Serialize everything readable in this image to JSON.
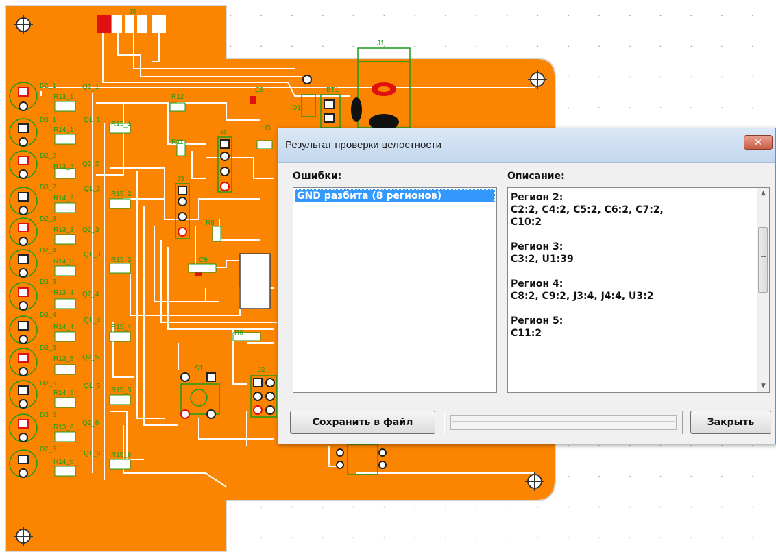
{
  "pcb": {
    "labels": {
      "j5": "J5",
      "j1": "J1",
      "bt1": "BT1",
      "c8": "C8",
      "r12": "R12",
      "j4": "J4",
      "u3": "U3",
      "r11": "R11",
      "j3": "J3",
      "r8": "R8",
      "c9": "C9",
      "r6": "R6",
      "s1": "S1",
      "j2": "J2",
      "d1": "D1",
      "d2_1": "D2_1",
      "r13_1": "R13_1",
      "q2_1": "Q2_1",
      "d3_1": "D3_1",
      "r14_1": "R14_1",
      "q1_1": "Q1_1",
      "r15_1": "R15_1",
      "d2_2": "D2_2",
      "r13_2": "R13_2",
      "q2_2": "Q2_2",
      "d3_2": "D3_2",
      "r14_2": "R14_2",
      "q1_2": "Q1_2",
      "r15_2": "R15_2",
      "d2_3": "D2_3",
      "r13_3": "R13_3",
      "q2_3": "Q2_3",
      "d2_4": "D2_4",
      "r14_3": "R14_3",
      "q1_3": "Q1_3",
      "r15_3": "R15_3",
      "d3_3": "D3_3",
      "r13_4": "R13_4",
      "q2_4": "Q2_4",
      "d3_4": "D3_4",
      "r14_4": "R14_4",
      "q1_4": "Q1_4",
      "r15_4": "R15_4",
      "d3_5": "D3_5",
      "r13_5": "R13_5",
      "q2_5": "Q2_5",
      "d2_5": "D2_5",
      "r14_5": "R14_5",
      "q1_5": "Q1_5",
      "r15_5": "R15_5",
      "d3_6": "D3_6",
      "r13_6": "R13_6",
      "q2_6": "Q2_6",
      "d2_6": "D2_6",
      "r14_6": "R14_6",
      "q1_6": "Q1_6",
      "r15_6": "R15_6"
    }
  },
  "dialog": {
    "title": "Результат проверки целостности",
    "close_glyph": "✕",
    "errors_label": "Ошибки:",
    "description_label": "Описание:",
    "errors": [
      "GND разбита (8 регионов)"
    ],
    "regions": [
      {
        "title": "Регион 2:",
        "line1": "C2:2, C4:2, C5:2, C6:2, C7:2,",
        "line2": "C10:2"
      },
      {
        "title": "Регион 3:",
        "line1": "C3:2, U1:39"
      },
      {
        "title": "Регион 4:",
        "line1": "C8:2, C9:2, J3:4, J4:4, U3:2"
      },
      {
        "title": "Регион 5:",
        "line1": "C11:2"
      }
    ],
    "save_button": "Сохранить в файл",
    "close_button": "Закрыть",
    "scroll_up": "▲",
    "scroll_down": "▼"
  },
  "colors": {
    "board": "#fb8500",
    "trace": "#ffffff",
    "silkscreen": "#1a9c1a",
    "pad_red": "#e01010",
    "dialog_bg": "#f0f0f0",
    "selection": "#3399ff"
  }
}
